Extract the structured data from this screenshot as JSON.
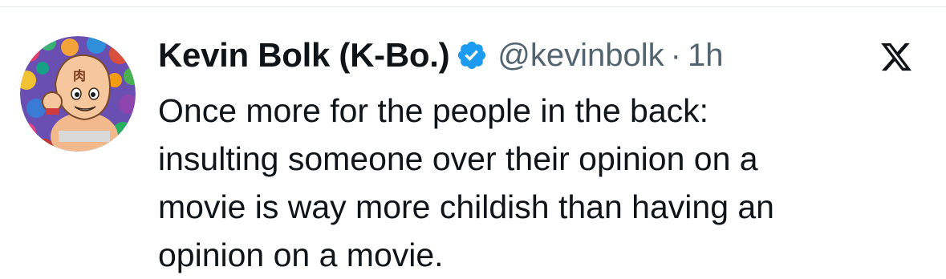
{
  "tweet": {
    "author": {
      "display_name": "Kevin Bolk (K-Bo.)",
      "handle": "@kevinbolk",
      "verified": true,
      "avatar": "cartoon-character-avatar"
    },
    "separator": "·",
    "time": "1h",
    "platform_icon": "x-logo-icon",
    "text_lines": [
      "Once more for the people in the back:",
      "insulting someone over their opinion on a",
      "movie is way more childish than having an",
      "opinion on a movie."
    ]
  },
  "colors": {
    "text_primary": "#0f1419",
    "text_secondary": "#536471",
    "verified_blue": "#1d9bf0",
    "divider": "#e4e9ed"
  }
}
